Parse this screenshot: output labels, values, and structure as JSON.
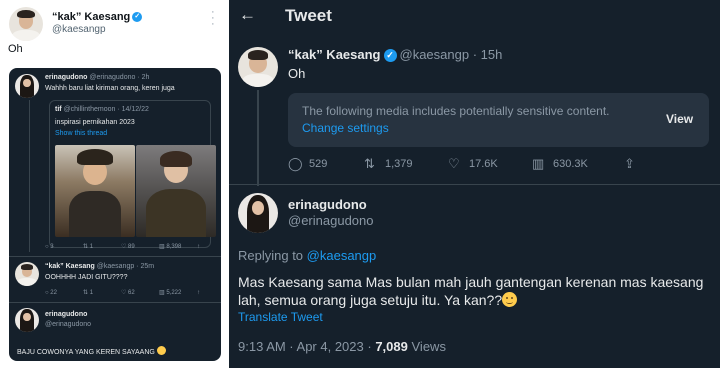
{
  "left": {
    "author_name": "“kak” Kaesang",
    "author_handle": "@kaesangp",
    "tweet_text": "Oh",
    "embedded": {
      "reply1": {
        "name": "erinagudono",
        "handle_time": "@erinagudono · 2h",
        "text": "Wahhh baru liat kiriman orang, keren juga",
        "quote": {
          "name": "tif",
          "handle_time": "@chillinthemoon · 14/12/22",
          "text": "inspirasi pernikahan 2023",
          "show_thread": "Show this thread"
        },
        "stats": [
          "3",
          "1",
          "89",
          "8,398"
        ]
      },
      "reply2": {
        "name": "“kak” Kaesang",
        "handle_time": "@kaesangp · 25m",
        "text": "OOHHHH JADI GITU????",
        "stats": [
          "22",
          "1",
          "62",
          "5,222"
        ]
      },
      "reply3": {
        "name": "erinagudono",
        "handle": "@erinagudono",
        "text": "BAJU COWONYA YANG KEREN SAYAANG"
      }
    }
  },
  "right": {
    "header_title": "Tweet",
    "tweet": {
      "name": "“kak” Kaesang",
      "handle_time": "@kaesangp · 15h",
      "text": "Oh",
      "sensitive_text": "The following media includes potentially sensitive content.",
      "change_settings": "Change settings",
      "view_label": "View",
      "stats": {
        "replies": "529",
        "retweets": "1,379",
        "likes": "17.6K",
        "views": "630.3K"
      }
    },
    "reply": {
      "name": "erinagudono",
      "handle": "@erinagudono",
      "replying_prefix": "Replying to",
      "replying_to": "@kaesangp",
      "text": "Mas Kaesang sama Mas bulan mah jauh gantengan kerenan mas kaesang lah, semua orang juga setuju itu. Ya kan??",
      "translate": "Translate Tweet",
      "timestamp": "9:13 AM · Apr 4, 2023 ·",
      "views_count": "7,089",
      "views_label": "Views"
    }
  },
  "colors": {
    "accent": "#1d9bf0",
    "dark_bg": "#15202b",
    "border": "#38444d",
    "muted": "#8b98a5"
  },
  "icons": [
    "verified-badge-icon",
    "more-icon",
    "back-arrow-icon",
    "reply-icon",
    "retweet-icon",
    "like-icon",
    "views-icon",
    "share-icon",
    "smile-emoji-icon"
  ]
}
